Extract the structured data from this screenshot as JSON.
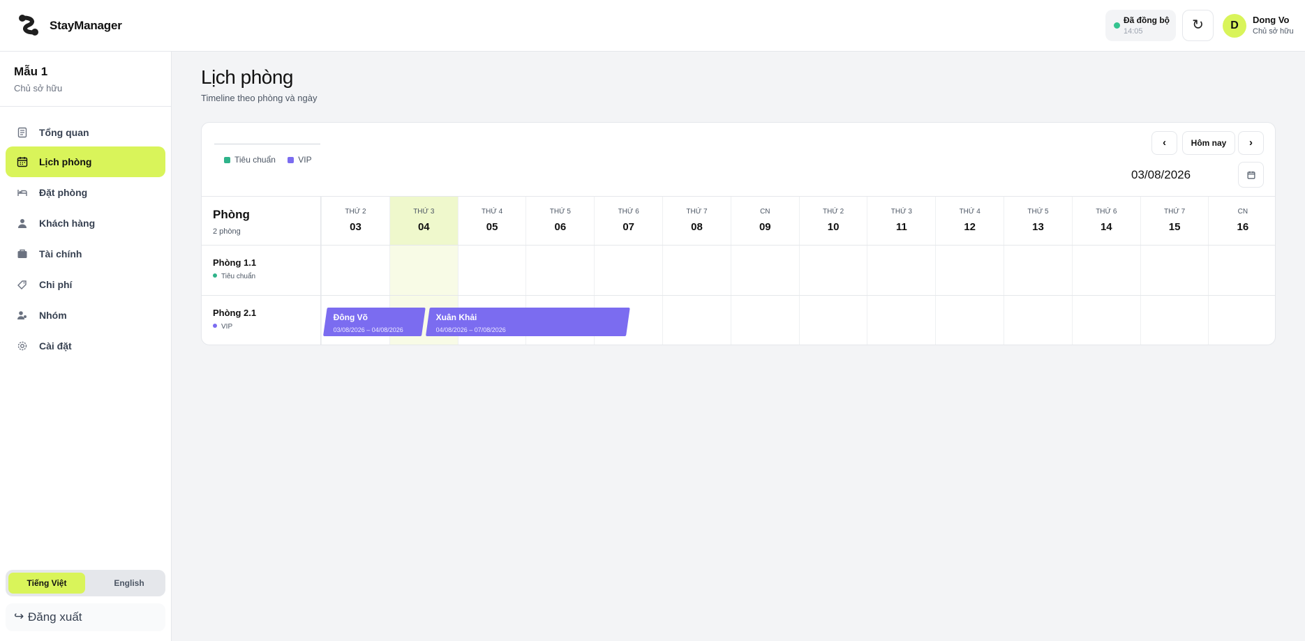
{
  "app": {
    "brand": "StayManager"
  },
  "header": {
    "sync_label": "Đã đồng bộ",
    "sync_time": "14:05",
    "refresh_icon": "↻",
    "user_initial": "D",
    "user_name": "Dong Vo",
    "user_role": "Chủ sở hữu"
  },
  "sidebar": {
    "org_name": "Mẫu 1",
    "org_role": "Chủ sở hữu",
    "items": [
      {
        "label": "Tổng quan",
        "icon": "document-icon"
      },
      {
        "label": "Lịch phòng",
        "icon": "calendar-icon",
        "active": true
      },
      {
        "label": "Đặt phòng",
        "icon": "bed-icon"
      },
      {
        "label": "Khách hàng",
        "icon": "user-icon"
      },
      {
        "label": "Tài chính",
        "icon": "wallet-icon"
      },
      {
        "label": "Chi phí",
        "icon": "tag-icon"
      },
      {
        "label": "Nhóm",
        "icon": "team-icon"
      },
      {
        "label": "Cài đặt",
        "icon": "gear-icon"
      }
    ],
    "languages": [
      "Tiếng Việt",
      "English"
    ],
    "active_language": "Tiếng Việt",
    "logout_icon": "↪",
    "logout_label": "Đăng xuất"
  },
  "main": {
    "title": "Lịch phòng",
    "subtitle": "Timeline theo phòng và ngày"
  },
  "calendar": {
    "legend": [
      {
        "label": "Tiêu chuẩn",
        "color": "#2fb38a"
      },
      {
        "label": "VIP",
        "color": "#7b6cf0"
      }
    ],
    "prev_label": "‹",
    "today_label": "Hôm nay",
    "next_label": "›",
    "selected_date": "03/08/2026",
    "rooms_header": "Phòng",
    "rooms_count": "2 phòng",
    "days": [
      {
        "dow": "THỨ 2",
        "num": "03"
      },
      {
        "dow": "THỨ 3",
        "num": "04",
        "today": true
      },
      {
        "dow": "THỨ 4",
        "num": "05"
      },
      {
        "dow": "THỨ 5",
        "num": "06"
      },
      {
        "dow": "THỨ 6",
        "num": "07"
      },
      {
        "dow": "THỨ 7",
        "num": "08"
      },
      {
        "dow": "CN",
        "num": "09"
      },
      {
        "dow": "THỨ 2",
        "num": "10"
      },
      {
        "dow": "THỨ 3",
        "num": "11"
      },
      {
        "dow": "THỨ 4",
        "num": "12"
      },
      {
        "dow": "THỨ 5",
        "num": "13"
      },
      {
        "dow": "THỨ 6",
        "num": "14"
      },
      {
        "dow": "THỨ 7",
        "num": "15"
      },
      {
        "dow": "CN",
        "num": "16"
      }
    ],
    "rooms": [
      {
        "name": "Phòng 1.1",
        "type": "Tiêu chuẩn",
        "type_color": "#2fb38a"
      },
      {
        "name": "Phòng 2.1",
        "type": "VIP",
        "type_color": "#7b6cf0"
      }
    ],
    "bookings": [
      {
        "room": 1,
        "guest": "Đông Võ",
        "dates": "03/08/2026 – 04/08/2026",
        "start_day": 0,
        "nights": 1.5
      },
      {
        "room": 1,
        "guest": "Xuân Khải",
        "dates": "04/08/2026 – 07/08/2026",
        "start_day": 1.5,
        "nights": 3
      }
    ]
  }
}
